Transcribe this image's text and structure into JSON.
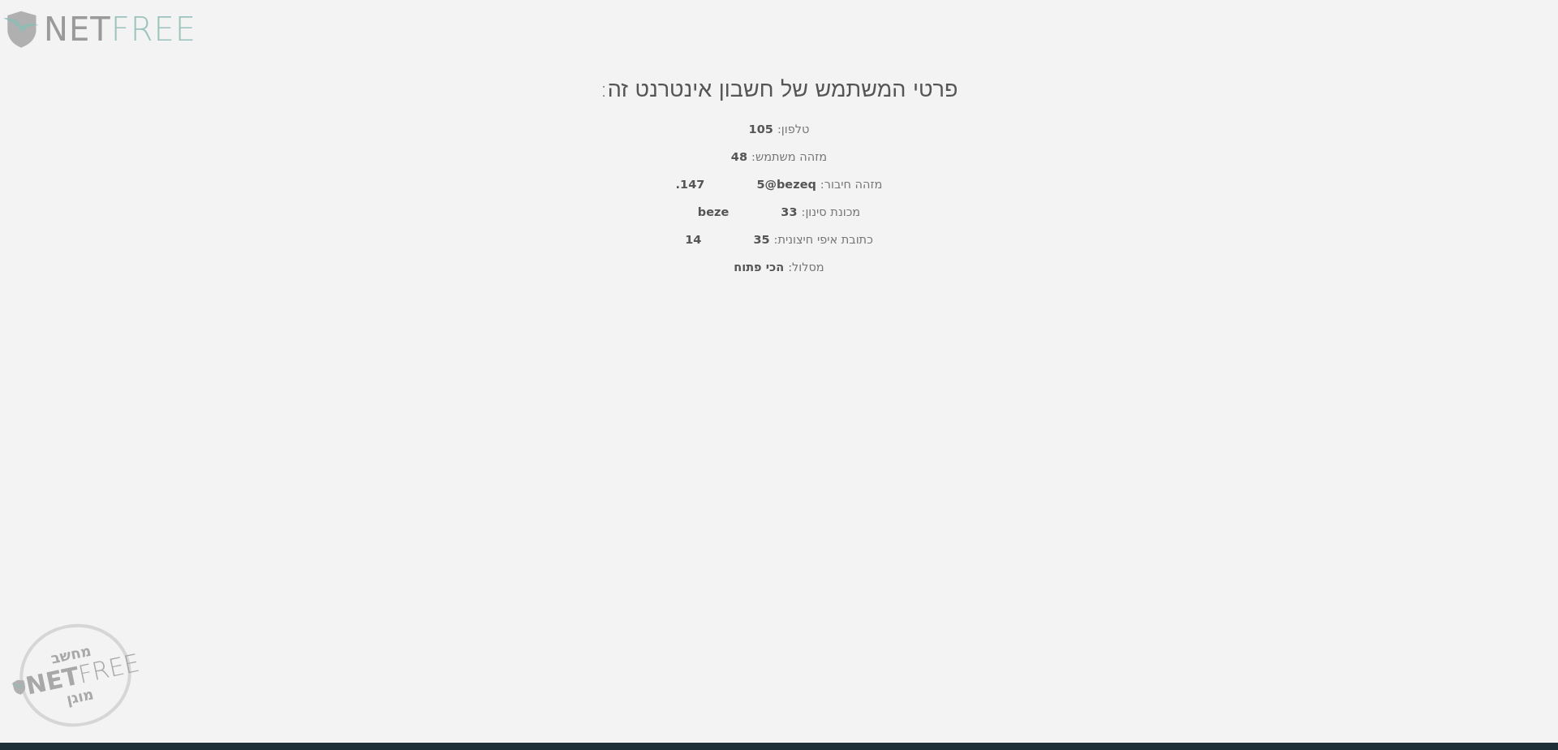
{
  "logo": {
    "part_1": "NET",
    "part_2": "FREE"
  },
  "title": "פרטי המשתמש של חשבון אינטרנט זה:",
  "details": [
    {
      "label": "טלפון:",
      "value": "105"
    },
    {
      "label": "מזהה משתמש:",
      "value": "48"
    },
    {
      "label": "מזהה חיבור:",
      "value": "5@bezeq",
      "extra": "147."
    },
    {
      "label": "מכונת סינון:",
      "value": "33",
      "extra": "beze"
    },
    {
      "label": "כתובת איפי חיצונית:",
      "value": "35",
      "extra": "14"
    },
    {
      "label": "מסלול:",
      "value": "הכי פתוח"
    }
  ],
  "stamp": {
    "top": "מחשב",
    "middle_1": "NET",
    "middle_2": "FREE",
    "bottom": "מוגן"
  }
}
